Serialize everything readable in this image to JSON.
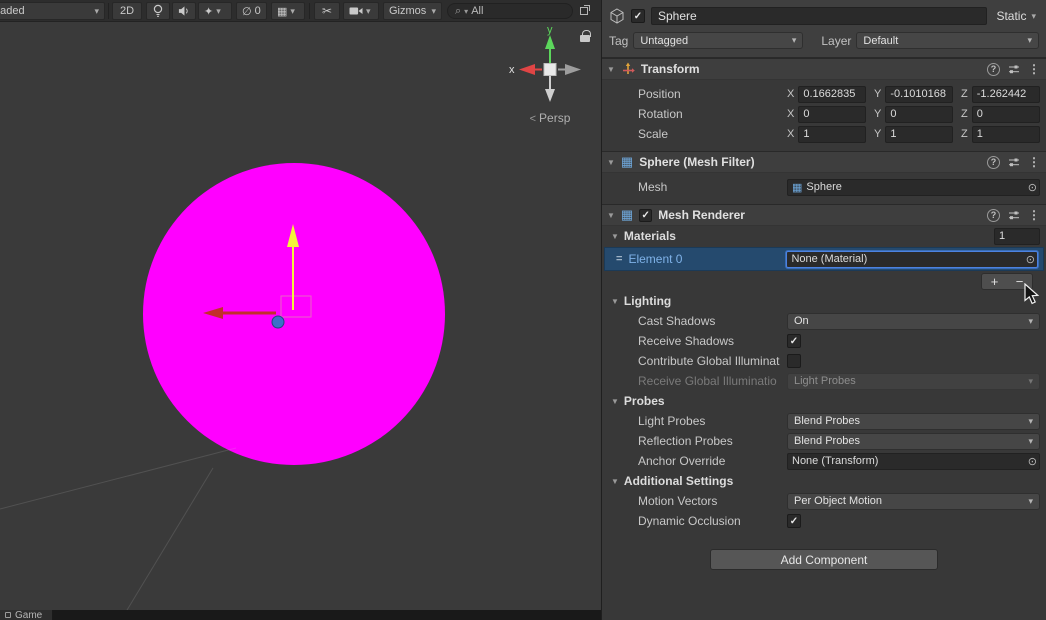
{
  "colors": {
    "sphere_missing_material": "#ff00ff",
    "selection_row": "#254a6e",
    "focus_border": "#4c82e0",
    "element_link_text": "#7fb2e8",
    "panel_bg": "#383838"
  },
  "scene": {
    "toolbar": {
      "shading_mode": "haded",
      "toggle_2d": "2D",
      "hidden_count": "0",
      "gizmos": "Gizmos",
      "search_value": "All"
    },
    "view": {
      "axis_x": "x",
      "axis_y": "y",
      "projection": "Persp"
    },
    "bottom_tab": "Game"
  },
  "inspector": {
    "header": {
      "name": "Sphere",
      "static": "Static",
      "tag_label": "Tag",
      "tag": "Untagged",
      "layer_label": "Layer",
      "layer": "Default"
    },
    "axes": {
      "x": "X",
      "y": "Y",
      "z": "Z"
    },
    "transform": {
      "title": "Transform",
      "rows": [
        {
          "label": "Position",
          "x": "0.1662835",
          "y": "-0.1010168",
          "z": "-1.262442"
        },
        {
          "label": "Rotation",
          "x": "0",
          "y": "0",
          "z": "0"
        },
        {
          "label": "Scale",
          "x": "1",
          "y": "1",
          "z": "1"
        }
      ]
    },
    "mesh_filter": {
      "title": "Sphere (Mesh Filter)",
      "mesh_label": "Mesh",
      "mesh_value": "Sphere"
    },
    "mesh_renderer": {
      "title": "Mesh Renderer",
      "materials": {
        "label": "Materials",
        "count": "1",
        "element_label": "Element 0",
        "element_value": "None (Material)"
      },
      "lighting": {
        "label": "Lighting",
        "cast_shadows_label": "Cast Shadows",
        "cast_shadows": "On",
        "receive_shadows_label": "Receive Shadows",
        "contribute_gi_label": "Contribute Global Illuminat",
        "receive_gi_label": "Receive Global Illuminatio",
        "receive_gi": "Light Probes"
      },
      "probes": {
        "label": "Probes",
        "light_probes_label": "Light Probes",
        "light_probes": "Blend Probes",
        "reflection_probes_label": "Reflection Probes",
        "reflection_probes": "Blend Probes",
        "anchor_label": "Anchor Override",
        "anchor": "None (Transform)"
      },
      "additional": {
        "label": "Additional Settings",
        "motion_vectors_label": "Motion Vectors",
        "motion_vectors": "Per Object Motion",
        "dynamic_occlusion_label": "Dynamic Occlusion"
      }
    },
    "add_component": "Add Component"
  },
  "icons": {
    "caret": "▾",
    "foldout_open": "▼",
    "search": "⌕",
    "grid": "▦",
    "fx": "✦",
    "eye_off": "∅",
    "tool": "✂",
    "help": "?",
    "menu": "⋮",
    "picker": "⊙",
    "check": "✓",
    "plus": "+",
    "minus": "−",
    "drag_handle": "=",
    "mesh": "▦",
    "persp_arrow": "<"
  }
}
